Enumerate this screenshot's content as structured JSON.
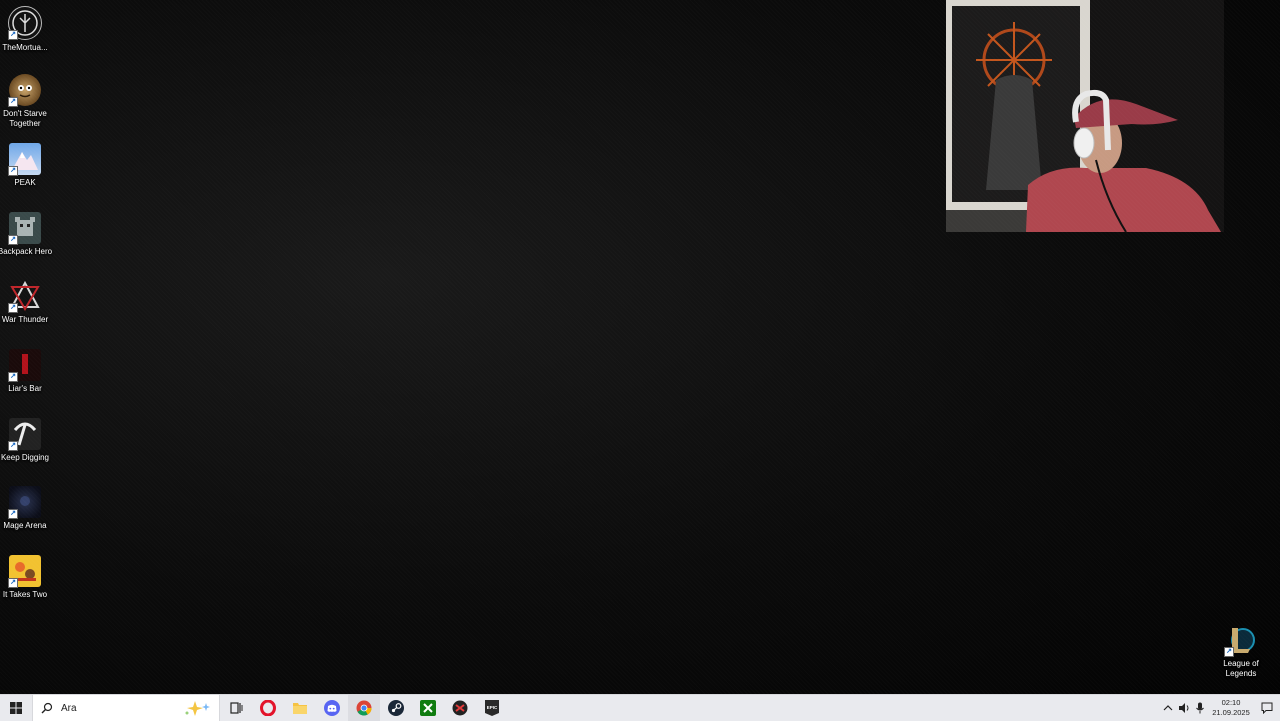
{
  "desktop": {
    "icons": [
      {
        "label": "TheMortua...",
        "icon": "mortuary-icon"
      },
      {
        "label": "Don't Starve Together",
        "icon": "dont-starve-icon"
      },
      {
        "label": "PEAK",
        "icon": "peak-icon"
      },
      {
        "label": "Backpack Hero",
        "icon": "backpack-hero-icon"
      },
      {
        "label": "War Thunder",
        "icon": "war-thunder-icon"
      },
      {
        "label": "Liar's Bar",
        "icon": "liars-bar-icon"
      },
      {
        "label": "Keep Digging",
        "icon": "keep-digging-icon"
      },
      {
        "label": "Mage Arena",
        "icon": "mage-arena-icon"
      },
      {
        "label": "It Takes Two",
        "icon": "it-takes-two-icon"
      },
      {
        "label": "League of Legends",
        "icon": "league-of-legends-icon"
      }
    ]
  },
  "taskbar": {
    "search_placeholder": "Ara",
    "pinned": [
      "task-view-icon",
      "opera-icon",
      "file-explorer-icon",
      "discord-icon",
      "chrome-icon",
      "steam-icon",
      "xbox-icon",
      "game-launcher-icon",
      "epic-games-icon"
    ],
    "clock": {
      "time": "02:10",
      "date": "21.09.2025"
    }
  }
}
